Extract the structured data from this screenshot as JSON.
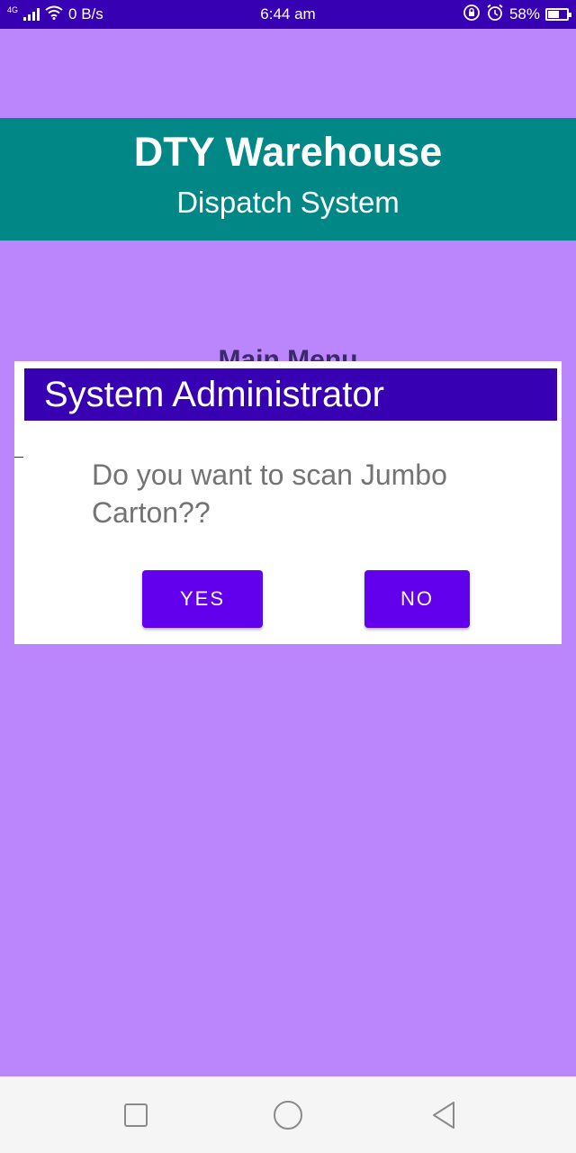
{
  "status_bar": {
    "network_type": "4G",
    "data_rate": "0 B/s",
    "time": "6:44 am",
    "battery_percent": "58%",
    "battery_level": 0.58,
    "icons": [
      "signal-icon",
      "wifi-icon",
      "lock-rotation-icon",
      "alarm-icon",
      "battery-icon"
    ]
  },
  "header": {
    "title": "DTY Warehouse",
    "subtitle": "Dispatch System"
  },
  "main": {
    "menu_title": "Main Menu"
  },
  "dialog": {
    "title": "System Administrator",
    "message": "Do you want to scan Jumbo Carton??",
    "yes_label": "YES",
    "no_label": "NO"
  },
  "nav_bar": {
    "icons": [
      "recent-apps-icon",
      "home-icon",
      "back-icon"
    ]
  },
  "colors": {
    "background": "#bb86fc",
    "status_bar": "#3700b3",
    "header": "#018786",
    "dialog_title": "#3700b3",
    "button": "#6200ee",
    "message_text": "#737373",
    "nav_bar": "#f5f5f5"
  }
}
